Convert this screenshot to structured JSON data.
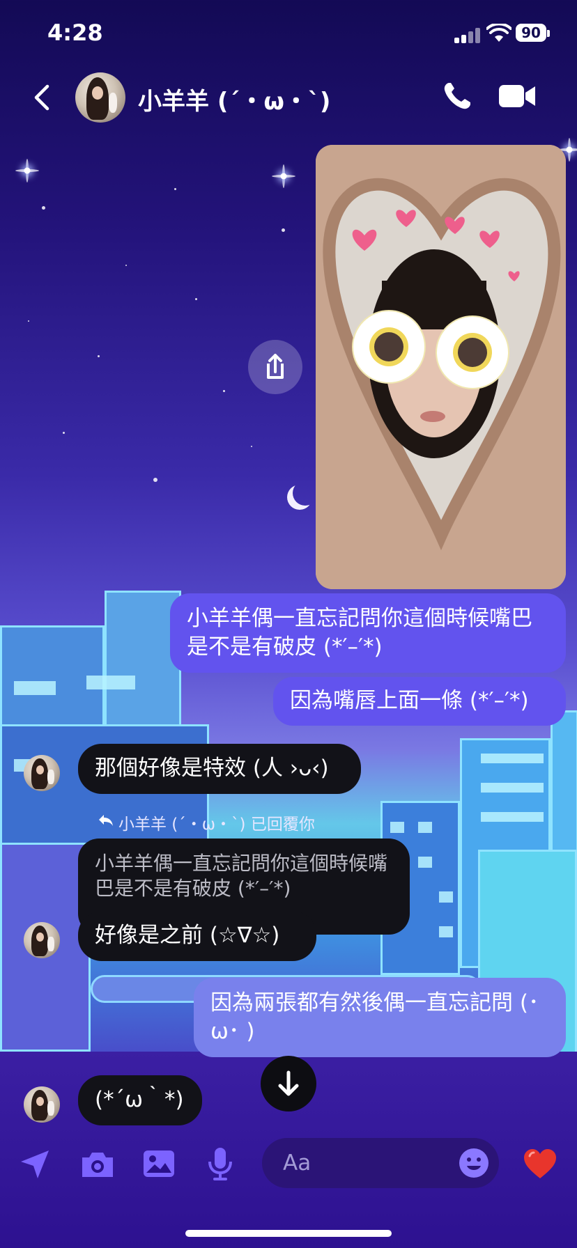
{
  "status_bar": {
    "time": "4:28",
    "battery": "90"
  },
  "header": {
    "contact_name": "小羊羊 (´・ω・`)"
  },
  "messages": {
    "m1": "小羊羊偶一直忘記問你這個時候嘴巴是不是有破皮 (*′–′*)",
    "m2": "因為嘴唇上面一條 (*′–′*)",
    "m3": "那個好像是特效 (人 ›ᴗ‹)",
    "reply_notice": "小羊羊 (´・ω・`) 已回覆你",
    "quoted": "小羊羊偶一直忘記問你這個時候嘴巴是不是有破皮 (*′–′*)",
    "m4": "好像是之前 (☆∇☆)",
    "m5": "因為兩張都有然後偶一直忘記問 (･ω･ )",
    "m6": "(*´ω｀*)"
  },
  "composer": {
    "placeholder": "Aa"
  },
  "colors": {
    "sent_bubble": "#6253ee",
    "received_bubble": "#121218",
    "heart": "#e8352c"
  },
  "icons": [
    "chevron-left-icon",
    "phone-icon",
    "video-camera-icon",
    "share-icon",
    "arrow-down-icon",
    "location-arrow-icon",
    "camera-icon",
    "image-icon",
    "microphone-icon",
    "emoji-icon",
    "heart-icon",
    "reply-icon"
  ]
}
